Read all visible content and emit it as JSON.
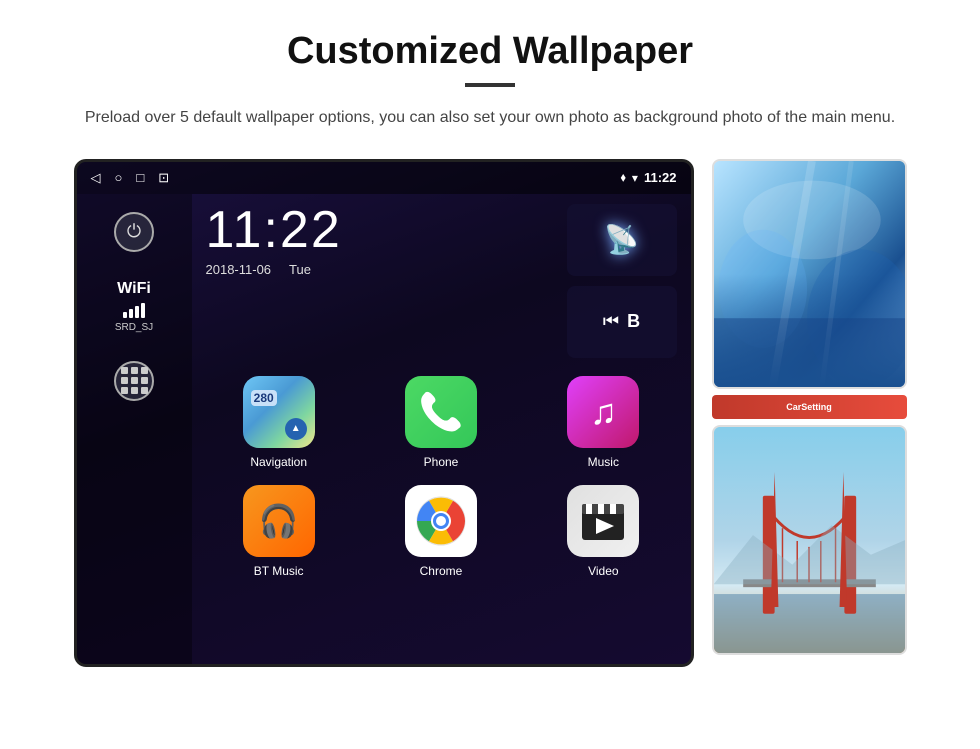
{
  "page": {
    "title": "Customized Wallpaper",
    "description": "Preload over 5 default wallpaper options, you can also set your own photo as background photo of the main menu."
  },
  "android": {
    "time": "11:22",
    "date": "2018-11-06",
    "day": "Tue",
    "wifi_label": "WiFi",
    "wifi_ssid": "SRD_SJ",
    "status_time": "11:22"
  },
  "apps": [
    {
      "label": "Navigation",
      "type": "nav"
    },
    {
      "label": "Phone",
      "type": "phone"
    },
    {
      "label": "Music",
      "type": "music"
    },
    {
      "label": "BT Music",
      "type": "btmusic"
    },
    {
      "label": "Chrome",
      "type": "chrome"
    },
    {
      "label": "Video",
      "type": "video"
    }
  ],
  "wallpaper": {
    "carsetting_label": "CarSetting"
  }
}
